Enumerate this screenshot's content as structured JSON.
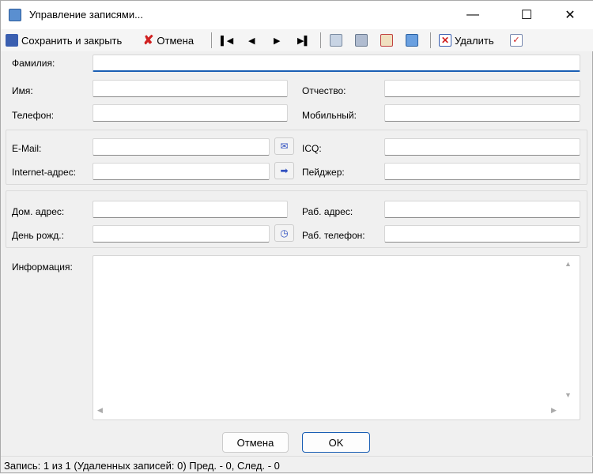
{
  "window": {
    "title": "Управление записями..."
  },
  "toolbar": {
    "save_close": "Сохранить и закрыть",
    "cancel": "Отмена",
    "delete": "Удалить"
  },
  "fields": {
    "surname": "Фамилия:",
    "name": "Имя:",
    "patronymic": "Отчество:",
    "phone": "Телефон:",
    "mobile": "Мобильный:",
    "email": "E-Mail:",
    "icq": "ICQ:",
    "internet": "Internet-адрес:",
    "pager": "Пейджер:",
    "home_address": "Дом. адрес:",
    "work_address": "Раб. адрес:",
    "birthday": "День рожд.:",
    "work_phone": "Раб. телефон:",
    "info": "Информация:"
  },
  "buttons": {
    "cancel": "Отмена",
    "ok": "OK"
  },
  "status": "Запись: 1 из 1 (Удаленных записей: 0) Пред. - 0, След. - 0"
}
